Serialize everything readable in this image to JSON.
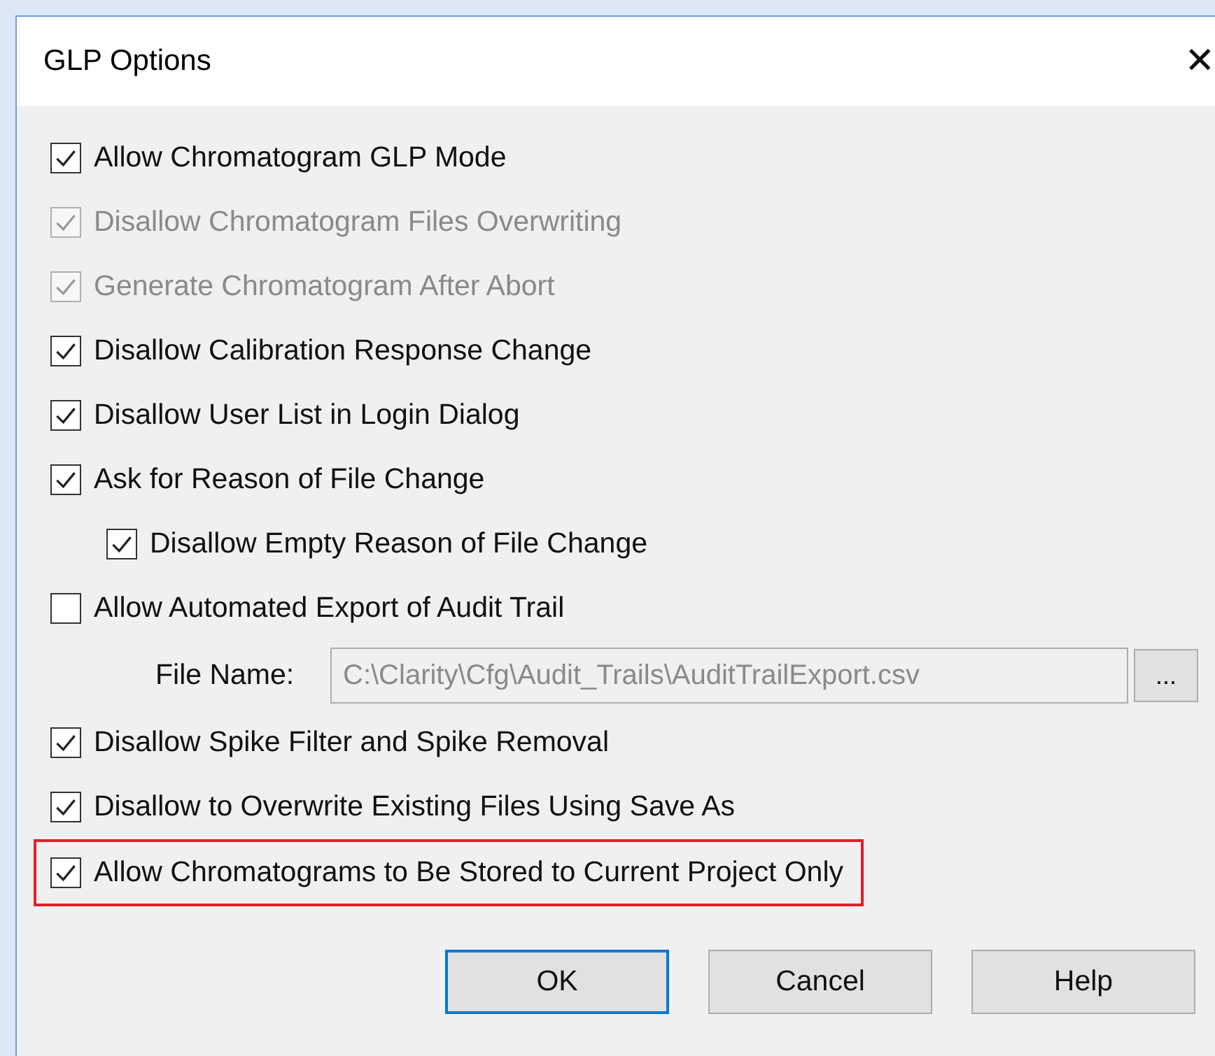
{
  "window": {
    "title": "GLP Options",
    "close": "✕"
  },
  "options": [
    {
      "kind": "checkbox",
      "label": "Allow Chromatogram GLP Mode",
      "checked": true,
      "disabled": false,
      "highlighted": false
    },
    {
      "kind": "checkbox",
      "label": "Disallow Chromatogram Files Overwriting",
      "checked": true,
      "disabled": true,
      "highlighted": false
    },
    {
      "kind": "checkbox",
      "label": "Generate Chromatogram After Abort",
      "checked": true,
      "disabled": true,
      "highlighted": false
    },
    {
      "kind": "checkbox",
      "label": "Disallow Calibration Response Change",
      "checked": true,
      "disabled": false,
      "highlighted": false
    },
    {
      "kind": "checkbox",
      "label": "Disallow User List in Login Dialog",
      "checked": true,
      "disabled": false,
      "highlighted": false
    },
    {
      "kind": "checkbox",
      "label": "Ask for Reason of File Change",
      "checked": true,
      "disabled": false,
      "highlighted": false,
      "children": [
        {
          "kind": "checkbox",
          "label": "Disallow Empty Reason of File Change",
          "checked": true,
          "disabled": false,
          "highlighted": false
        }
      ]
    },
    {
      "kind": "checkbox",
      "label": "Allow Automated Export of Audit Trail",
      "checked": false,
      "disabled": false,
      "highlighted": false
    },
    {
      "kind": "file",
      "label": "File Name:",
      "value": "C:\\Clarity\\Cfg\\Audit_Trails\\AuditTrailExport.csv",
      "disabled": true,
      "browse": "..."
    },
    {
      "kind": "checkbox",
      "label": "Disallow Spike Filter and Spike Removal",
      "checked": true,
      "disabled": false,
      "highlighted": false
    },
    {
      "kind": "checkbox",
      "label": "Disallow to Overwrite Existing Files Using Save As",
      "checked": true,
      "disabled": false,
      "highlighted": false
    },
    {
      "kind": "checkbox",
      "label": "Allow Chromatograms to Be Stored to Current Project Only",
      "checked": true,
      "disabled": false,
      "highlighted": true
    }
  ],
  "buttons": [
    {
      "label": "OK",
      "selected": true
    },
    {
      "label": "Cancel",
      "selected": false
    },
    {
      "label": "Help",
      "selected": false
    }
  ]
}
